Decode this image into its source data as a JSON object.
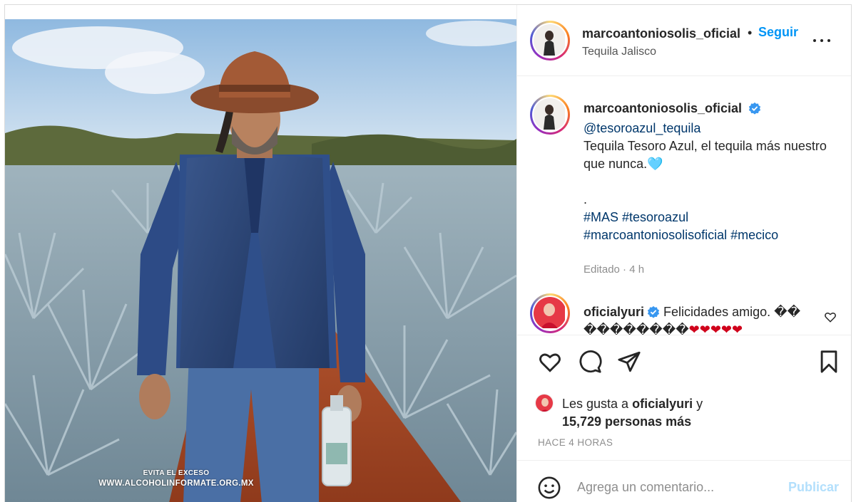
{
  "post": {
    "username": "marcoantoniosolis_oficial",
    "separator": "•",
    "follow_label": "Seguir",
    "location": "Tequila Jalisco",
    "more_icon": "more-options-icon"
  },
  "media": {
    "watermark_line1": "EVITA EL EXCESO",
    "watermark_line2": "WWW.ALCOHOLINFORMATE.ORG.MX"
  },
  "caption": {
    "username": "marcoantoniosolis_oficial",
    "verified_icon": "verified-badge-icon",
    "mention": "@tesoroazul_tequila",
    "text": "Tequila Tesoro Azul, el tequila más nuestro que nunca.",
    "emoji": "🩵",
    "dot": ".",
    "hashtags_line1": "#MAS #tesoroazul",
    "hashtags_line2": "#marcoantoniosolisoficial #mecico",
    "meta": "Editado · 4 h"
  },
  "comment": {
    "username": "oficialyuri",
    "text_line1": "Felicidades amigo. ��",
    "text_line2_boxes": "��������",
    "hearts": "❤❤❤❤❤"
  },
  "actions": {
    "icons": [
      "heart-icon",
      "comment-icon",
      "share-icon",
      "bookmark-icon"
    ]
  },
  "likes": {
    "prefix": "Les gusta a",
    "user": "oficialyuri",
    "conj": "y",
    "count": "15,729 personas más"
  },
  "time_label": "HACE 4 HORAS",
  "add_comment": {
    "placeholder": "Agrega un comentario...",
    "publish_label": "Publicar"
  },
  "colors": {
    "accent": "#0095f6",
    "link": "#00376b",
    "muted": "#8e8e8e",
    "publish_disabled": "#b2dffc",
    "heart": "#d0021b",
    "teal_heart": "#2ec4c6"
  }
}
